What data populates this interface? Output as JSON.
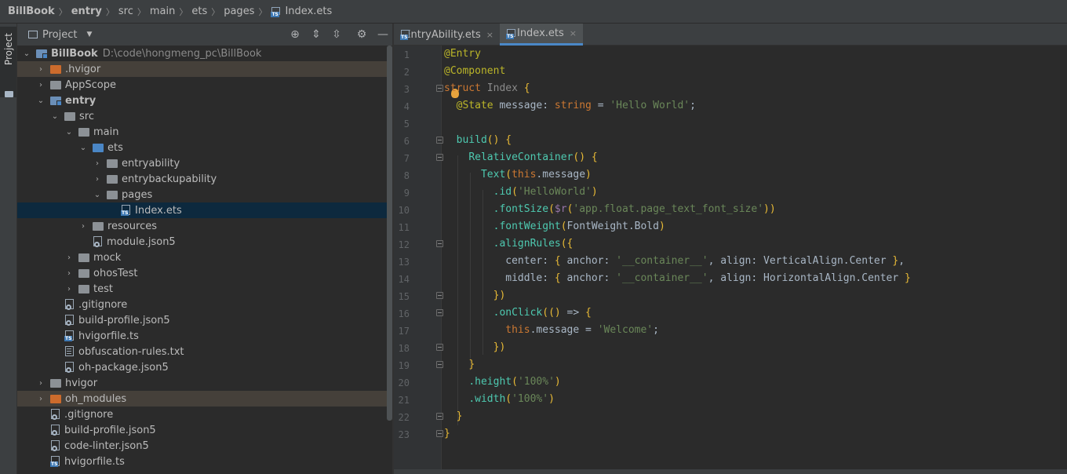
{
  "breadcrumb": {
    "items": [
      "BillBook",
      "entry",
      "src",
      "main",
      "ets",
      "pages",
      "Index.ets"
    ]
  },
  "left_strip": {
    "label": "Project"
  },
  "project_panel": {
    "title": "Project",
    "root_name": "BillBook",
    "root_path": "D:\\code\\hongmeng_pc\\BillBook",
    "tree": [
      {
        "label": ".hvigor"
      },
      {
        "label": "AppScope"
      },
      {
        "label": "entry"
      },
      {
        "label": "src"
      },
      {
        "label": "main"
      },
      {
        "label": "ets"
      },
      {
        "label": "entryability"
      },
      {
        "label": "entrybackupability"
      },
      {
        "label": "pages"
      },
      {
        "label": "Index.ets"
      },
      {
        "label": "resources"
      },
      {
        "label": "module.json5"
      },
      {
        "label": "mock"
      },
      {
        "label": "ohosTest"
      },
      {
        "label": "test"
      },
      {
        "label": ".gitignore"
      },
      {
        "label": "build-profile.json5"
      },
      {
        "label": "hvigorfile.ts"
      },
      {
        "label": "obfuscation-rules.txt"
      },
      {
        "label": "oh-package.json5"
      },
      {
        "label": "hvigor"
      },
      {
        "label": "oh_modules"
      },
      {
        "label": ".gitignore"
      },
      {
        "label": "build-profile.json5"
      },
      {
        "label": "code-linter.json5"
      },
      {
        "label": "hvigorfile.ts"
      }
    ]
  },
  "editor": {
    "tabs": [
      {
        "label": "EntryAbility.ets",
        "close": "×"
      },
      {
        "label": "Index.ets",
        "close": "×"
      }
    ],
    "line_numbers": [
      "1",
      "2",
      "3",
      "4",
      "5",
      "6",
      "7",
      "8",
      "9",
      "10",
      "11",
      "12",
      "13",
      "14",
      "15",
      "16",
      "17",
      "18",
      "19",
      "20",
      "21",
      "22",
      "23"
    ],
    "code_lines": [
      "@Entry",
      "@Component",
      "struct Index {",
      "  @State message: string = 'Hello World';",
      "",
      "  build() {",
      "    RelativeContainer() {",
      "      Text(this.message)",
      "        .id('HelloWorld')",
      "        .fontSize($r('app.float.page_text_font_size'))",
      "        .fontWeight(FontWeight.Bold)",
      "        .alignRules({",
      "          center: { anchor: '__container__', align: VerticalAlign.Center },",
      "          middle: { anchor: '__container__', align: HorizontalAlign.Center }",
      "        })",
      "        .onClick(() => {",
      "          this.message = 'Welcome';",
      "        })",
      "    }",
      "    .height('100%')",
      "    .width('100%')",
      "  }",
      "}"
    ]
  },
  "colors": {
    "accent": "#4a88c7",
    "selection": "#0d293e",
    "excluded_folder": "#45403a"
  }
}
